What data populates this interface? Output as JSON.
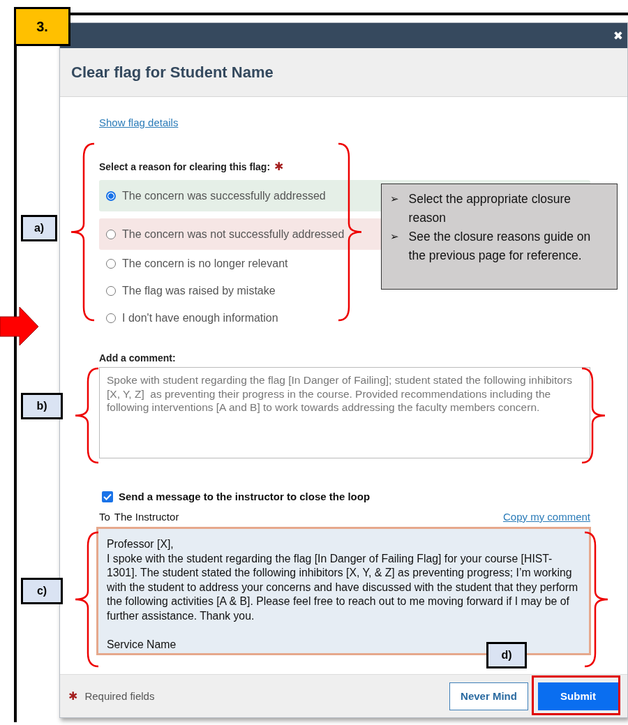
{
  "step_label": "3.",
  "dialog": {
    "title": "Clear flag for Student Name",
    "close_icon": "✖",
    "show_details_link": "Show flag details",
    "reason_label": "Select a reason for clearing this flag:",
    "required_mark": "✱",
    "reasons": [
      {
        "label": "The concern was successfully addressed",
        "selected": true,
        "kind": "positive"
      },
      {
        "label": "The concern was not successfully addressed",
        "selected": false,
        "kind": "negative"
      },
      {
        "label": "The concern is no longer relevant",
        "selected": false,
        "kind": "plain"
      },
      {
        "label": "The flag was raised by mistake",
        "selected": false,
        "kind": "plain"
      },
      {
        "label": "I don't have enough information",
        "selected": false,
        "kind": "plain"
      }
    ],
    "comment_label": "Add a comment:",
    "comment": "Spoke with student regarding the flag [In Danger of Failing]; student stated the following inhibitors [X, Y, Z]  as preventing their progress in the course. Provided recommendations including the following interventions [A and B] to work towards addressing the faculty members concern.",
    "send_message": {
      "label": "Send a message to the instructor to close the loop",
      "checked": true
    },
    "to_label": "To",
    "recipient": "The Instructor",
    "copy_link": "Copy my comment",
    "message": {
      "greeting": "Professor [X],",
      "body": "I spoke with the student regarding the flag [In Danger of Failing Flag] for your course [HIST-1301]. The student stated the following inhibitors [X, Y, & Z] as preventing progress; I’m working with the student to address your concerns and have discussed with the student that they perform the following activities [A & B]. Please feel free to reach out to me moving forward if I may be of further assistance. Thank you.",
      "signature": "Service Name"
    },
    "footer": {
      "required_mark": "✱",
      "required_text": "Required fields",
      "buttons": [
        {
          "label": "Never Mind",
          "kind": "secondary"
        },
        {
          "label": "Submit",
          "kind": "primary"
        }
      ]
    }
  },
  "annotations": {
    "labels": [
      "a)",
      "b)",
      "c)",
      "d)"
    ],
    "callout": [
      "Select the appropriate closure reason",
      "See the closure reasons guide on the previous page for reference."
    ],
    "bullet": "➢"
  }
}
